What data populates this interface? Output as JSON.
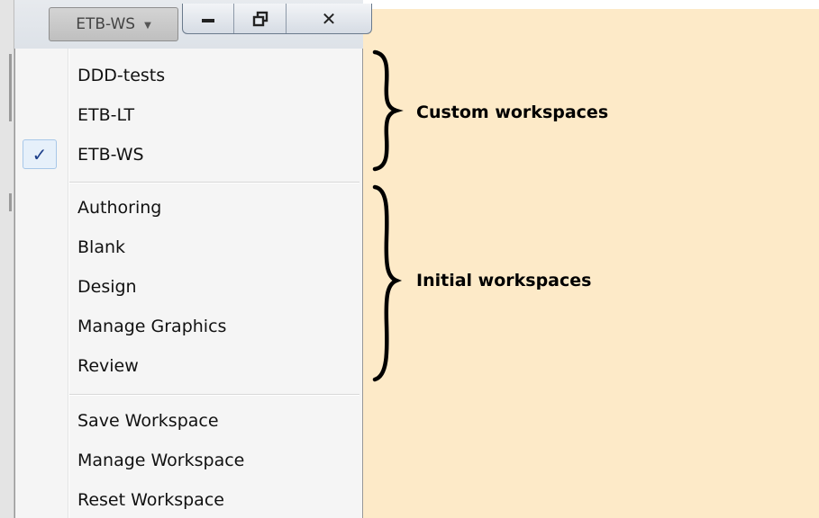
{
  "titlebar": {
    "workspace_button": "ETB-WS",
    "minimize_glyph": "–",
    "restore_glyph": "🗗",
    "close_glyph": "✕"
  },
  "menu": {
    "custom": [
      {
        "label": "DDD-tests",
        "checked": false
      },
      {
        "label": "ETB-LT",
        "checked": false
      },
      {
        "label": "ETB-WS",
        "checked": true
      }
    ],
    "initial": [
      {
        "label": "Authoring"
      },
      {
        "label": "Blank"
      },
      {
        "label": "Design"
      },
      {
        "label": "Manage Graphics"
      },
      {
        "label": "Review"
      }
    ],
    "actions": [
      {
        "label": "Save Workspace"
      },
      {
        "label": "Manage Workspace"
      },
      {
        "label": "Reset Workspace"
      }
    ],
    "check_glyph": "✓"
  },
  "annotations": {
    "custom_label": "Custom workspaces",
    "initial_label": "Initial workspaces"
  },
  "colors": {
    "annotation_bg": "#fdeac8",
    "menu_bg": "#f5f5f5",
    "check_color": "#1d3f8a"
  }
}
